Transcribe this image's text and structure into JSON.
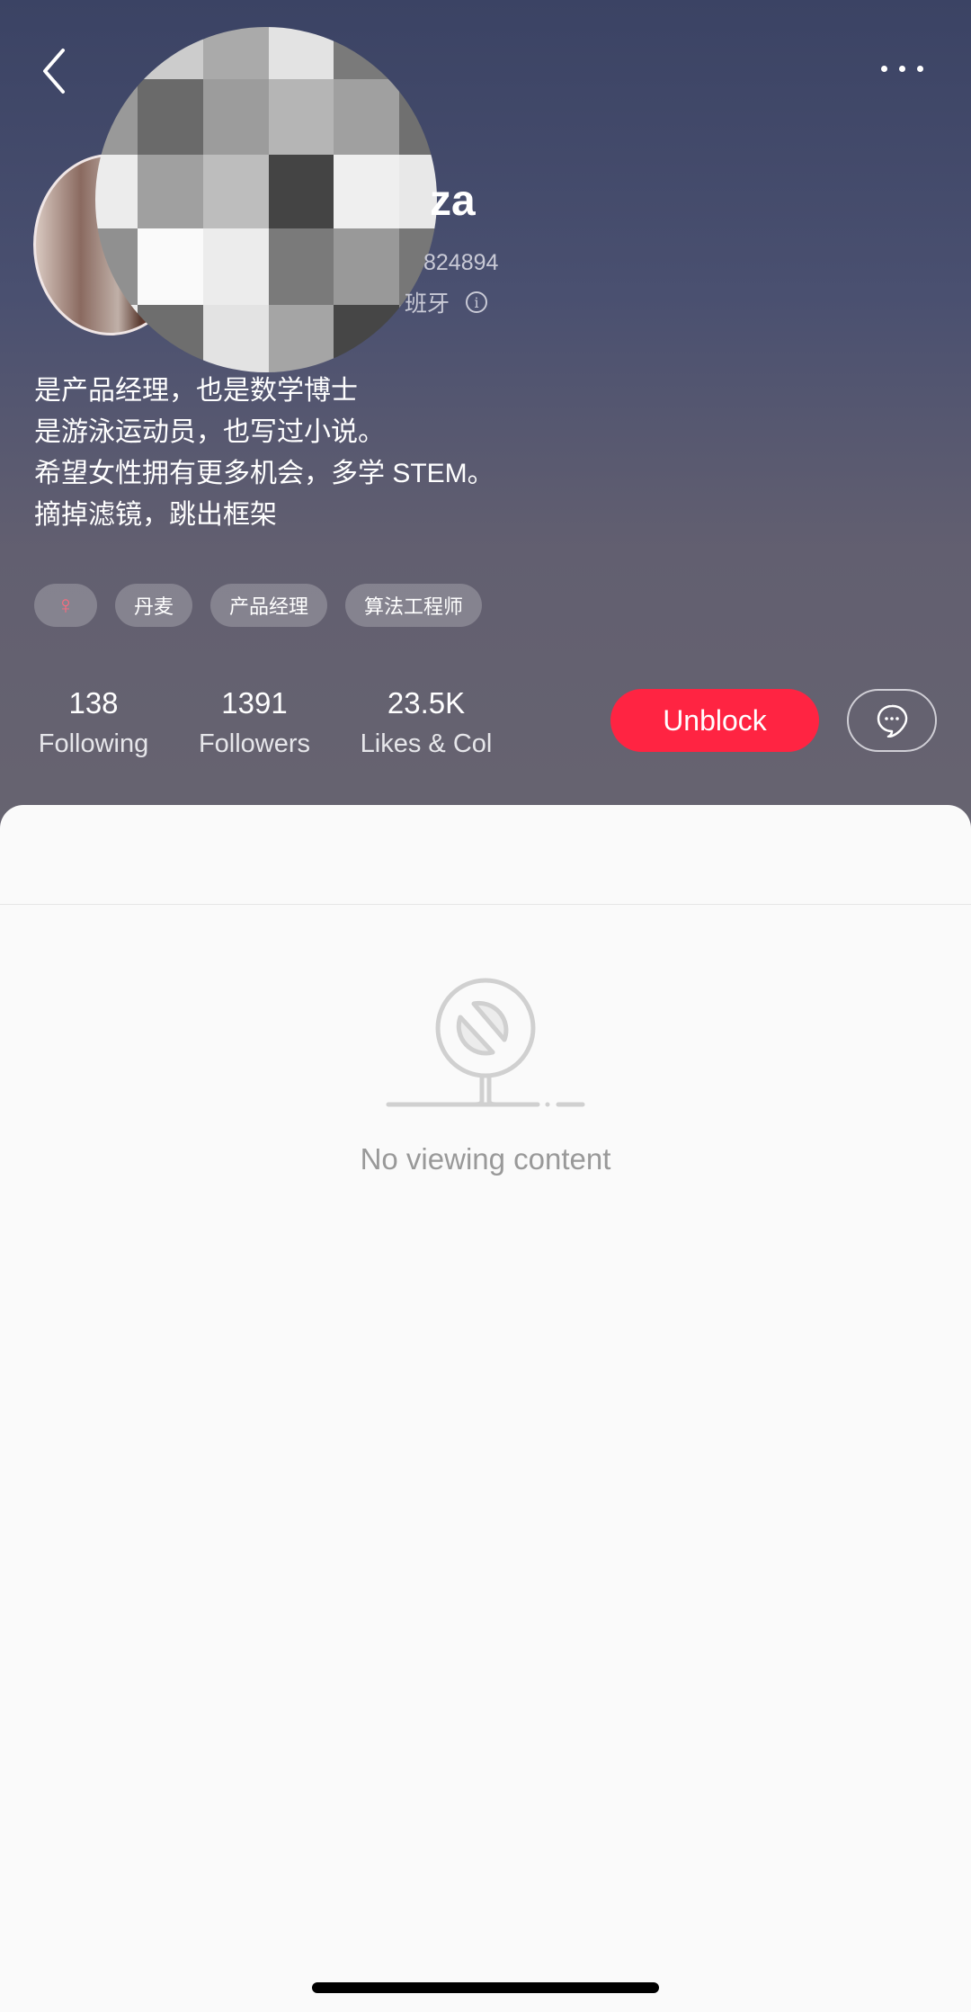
{
  "header": {
    "back_icon": "chevron-left-icon",
    "more_icon": "ellipsis-icon"
  },
  "profile": {
    "name_visible": "za",
    "id_visible": "824894",
    "location_visible": "班牙",
    "info_icon": "info-icon",
    "bio": [
      "是产品经理，也是数学博士",
      "是游泳运动员，也写过小说。",
      "希望女性拥有更多机会，多学 STEM。",
      "摘掉滤镜，跳出框架"
    ],
    "tags": [
      "♀",
      "丹麦",
      "产品经理",
      "算法工程师"
    ]
  },
  "stats": [
    {
      "value": "138",
      "label": "Following"
    },
    {
      "value": "1391",
      "label": "Followers"
    },
    {
      "value": "23.5K",
      "label": "Likes & Col"
    }
  ],
  "actions": {
    "unblock_label": "Unblock",
    "chat_icon": "chat-bubble-icon",
    "accent": "#ff2442"
  },
  "content": {
    "empty_text": "No viewing content",
    "empty_icon": "blocked-sign-icon"
  }
}
